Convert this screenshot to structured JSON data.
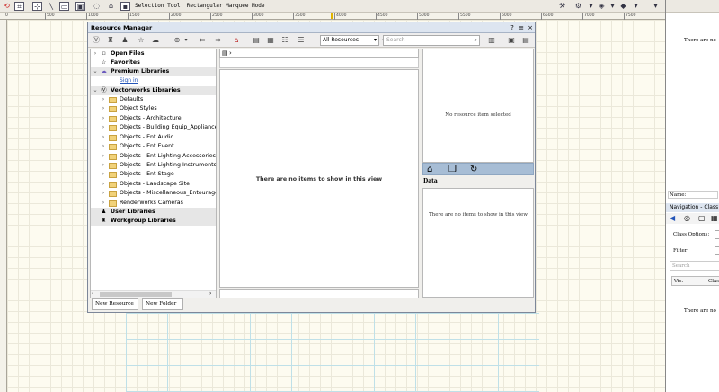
{
  "toolbar": {
    "status_text": "Selection Tool: Rectangular Marquee Mode"
  },
  "ruler": {
    "ticks": [
      "0",
      "500",
      "1000",
      "1500",
      "2000",
      "2500",
      "3000",
      "3500",
      "4000",
      "4500",
      "5000",
      "5500",
      "6000",
      "6500",
      "7000",
      "7500"
    ]
  },
  "resource_manager": {
    "title": "Resource Manager",
    "help": "?",
    "menu": "≡",
    "close": "×",
    "filter_value": "All Resources",
    "search_placeholder": "Search",
    "tree": {
      "open_files": "Open Files",
      "favorites": "Favorites",
      "premium": "Premium Libraries",
      "sign_in": "Sign in",
      "vectorworks": "Vectorworks Libraries",
      "folders": [
        "Defaults",
        "Object Styles",
        "Objects - Architecture",
        "Objects - Building Equip_Appliances",
        "Objects - Ent Audio",
        "Objects - Ent Event",
        "Objects - Ent Lighting Accessories",
        "Objects - Ent Lighting Instruments",
        "Objects - Ent Stage",
        "Objects - Landscape Site",
        "Objects - Miscellaneous_Entourage",
        "Renderworks Cameras"
      ],
      "user": "User Libraries",
      "workgroup": "Workgroup Libraries"
    },
    "middle": {
      "empty_message": "There are no items to show in this view"
    },
    "preview": {
      "empty_message": "No resource item selected"
    },
    "data": {
      "label": "Data",
      "empty_message": "There are no items to show in this view"
    },
    "buttons": {
      "new_resource": "New Resource",
      "new_folder": "New Folder"
    }
  },
  "right_panel": {
    "top_message": "There are no",
    "name_label": "Name:",
    "nav_title": "Navigation - Class",
    "class_options": "Class Options:",
    "filter": "Filter",
    "search": "Search",
    "col_vis": "Vis.",
    "col_class": "Class",
    "bottom_message": "There are no"
  }
}
